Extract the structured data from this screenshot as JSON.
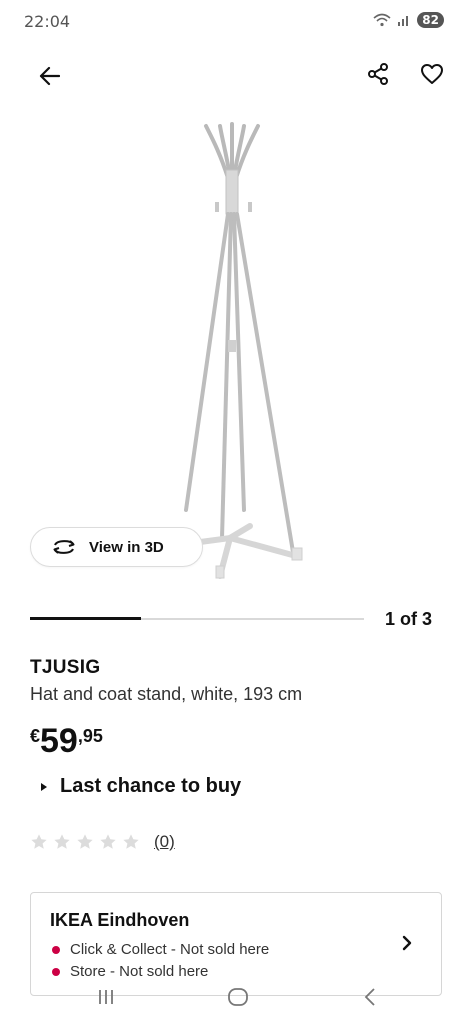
{
  "status_bar": {
    "time": "22:04",
    "battery": "82",
    "icons": [
      "wifi-icon",
      "signal-icon"
    ]
  },
  "toolbar": {
    "back_icon": "arrow-left-icon",
    "share_icon": "share-icon",
    "favorite_icon": "heart-icon"
  },
  "gallery": {
    "view_3d_label": "View in 3D",
    "view_3d_icon": "rotate-3d-icon",
    "progress_fraction": 0.333,
    "counter": "1 of 3"
  },
  "product": {
    "name": "TJUSIG",
    "description": "Hat and coat stand, white, 193 cm",
    "price_currency": "€",
    "price_integer": "59",
    "price_decimal": ",95",
    "availability": "Last chance to buy",
    "rating_stars": 0,
    "rating_max": 5,
    "rating_count": "(0)"
  },
  "store": {
    "name": "IKEA Eindhoven",
    "click_collect": "Click & Collect - Not sold here",
    "in_store": "Store - Not sold here",
    "status_color": "#cc0044"
  },
  "nav": {
    "icons": [
      "recent-apps-icon",
      "home-icon",
      "back-icon"
    ]
  }
}
